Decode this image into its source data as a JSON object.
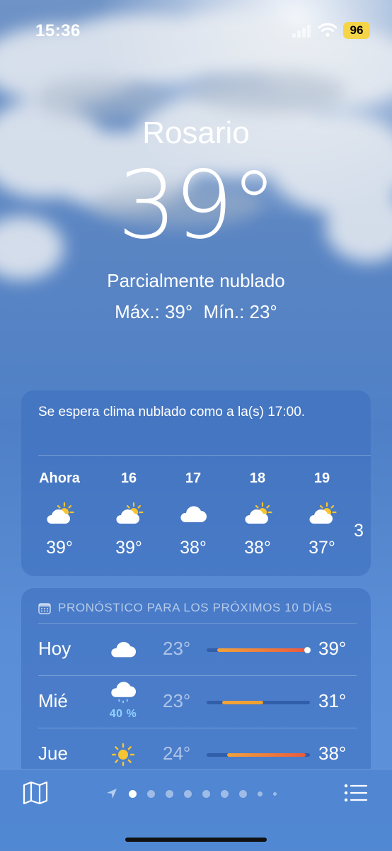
{
  "status_bar": {
    "time": "15:36",
    "battery": "96"
  },
  "location": {
    "city": "Rosario",
    "temperature": "39°",
    "condition": "Parcialmente nublado",
    "high": "Máx.: 39°",
    "low": "Mín.: 23°"
  },
  "hourly": {
    "summary": "Se espera clima nublado como a la(s) 17:00.",
    "hours": [
      {
        "label": "Ahora",
        "icon": "partly-cloudy-icon",
        "temp": "39°"
      },
      {
        "label": "16",
        "icon": "partly-cloudy-icon",
        "temp": "39°"
      },
      {
        "label": "17",
        "icon": "cloud-icon",
        "temp": "38°"
      },
      {
        "label": "18",
        "icon": "partly-cloudy-icon",
        "temp": "38°"
      },
      {
        "label": "19",
        "icon": "partly-cloudy-icon",
        "temp": "37°"
      },
      {
        "label": "",
        "icon": "",
        "temp": "3"
      }
    ]
  },
  "daily": {
    "header": "PRONÓSTICO PARA LOS PRÓXIMOS 10 DÍAS",
    "days": [
      {
        "name": "Hoy",
        "icon": "cloud-icon",
        "precip": "",
        "low": "23°",
        "high": "39°",
        "bar_start": 0.1,
        "bar_end": 0.96,
        "current": 0.97,
        "colors": [
          "#f2a33a",
          "#ec5a3c"
        ]
      },
      {
        "name": "Mié",
        "icon": "cloud-rain-icon",
        "precip": "40 %",
        "low": "23°",
        "high": "31°",
        "bar_start": 0.15,
        "bar_end": 0.55,
        "current": null,
        "colors": [
          "#f2a33a",
          "#f0a030"
        ]
      },
      {
        "name": "Jue",
        "icon": "sun-icon",
        "precip": "",
        "low": "24°",
        "high": "38°",
        "bar_start": 0.2,
        "bar_end": 0.96,
        "current": null,
        "colors": [
          "#f2a33a",
          "#ec5a3c"
        ]
      }
    ]
  },
  "bottom_bar": {
    "pages": 9,
    "active_page": 1
  },
  "colors": {
    "accent_precip": "#8fd0ff",
    "battery": "#f5d547",
    "sun": "#f7c531"
  }
}
